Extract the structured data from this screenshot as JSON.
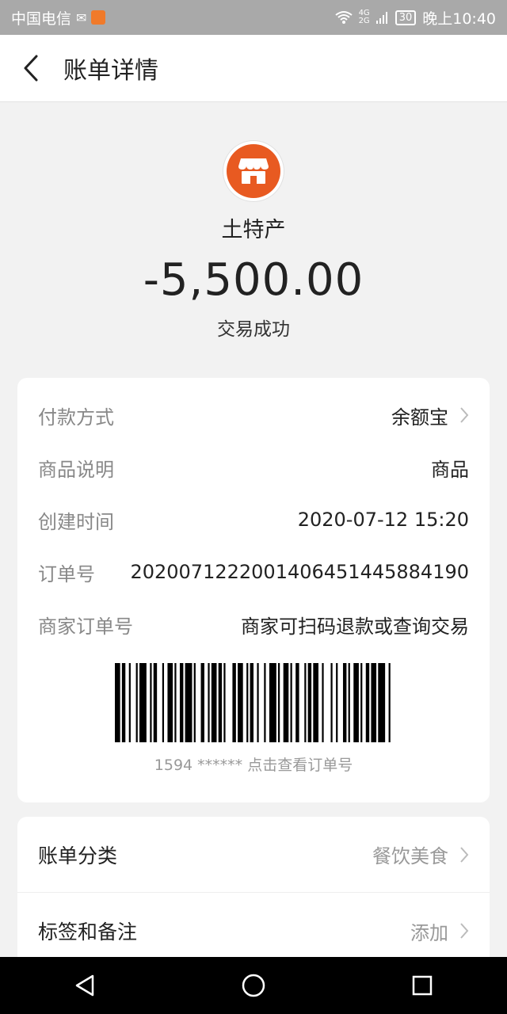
{
  "statusbar": {
    "carrier": "中国电信",
    "network": [
      "4G",
      "2G"
    ],
    "battery": "30",
    "time": "晚上10:40"
  },
  "header": {
    "title": "账单详情"
  },
  "merchant": {
    "name": "土特产",
    "amount": "-5,500.00",
    "status": "交易成功",
    "logo_color": "#e85a21"
  },
  "details": [
    {
      "label": "付款方式",
      "value": "余额宝",
      "has_chevron": true
    },
    {
      "label": "商品说明",
      "value": "商品"
    },
    {
      "label": "创建时间",
      "value": "2020-07-12 15:20"
    },
    {
      "label": "订单号",
      "value": "2020071222001406451445884190"
    },
    {
      "label": "商家订单号",
      "value": "商家可扫码退款或查询交易"
    }
  ],
  "barcode": {
    "caption": "1594 ****** 点击查看订单号"
  },
  "extras": [
    {
      "label": "账单分类",
      "value": "餐饮美食"
    },
    {
      "label": "标签和备注",
      "value": "添加"
    }
  ],
  "icons": {
    "back": "chevron-left-icon",
    "chevron": "chevron-right-icon",
    "store": "store-icon",
    "nav": [
      "back-triangle-icon",
      "home-circle-icon",
      "recents-square-icon"
    ]
  }
}
